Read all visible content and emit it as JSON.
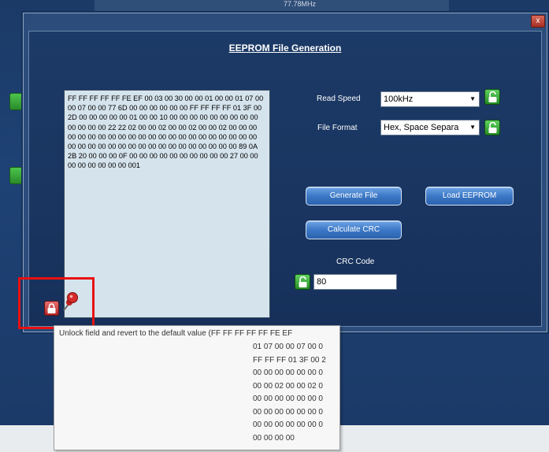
{
  "window": {
    "title": "EEPROM File Generation",
    "close_label": "x",
    "background_top_text": "77.78MHz"
  },
  "hex_data": "FF FF FF FF FF FE EF 00 03 00 30 00 00 01 00 00 01 07 00 00 07 00 00 77 6D 00 00 00 00 00 00 FF FF FF FF 01 3F 00 2D 00 00 00 00 00 01 00 00 10 00 00 00 00 00 00 00 00 00 00 00 00 00 22 22 02 00 00 02 00 00 02 00 00 02 00 00 00 00 00 00 00 00 00 00 00 00 00 00 00 00 00 00 00 00 00 00 00 00 00 00 00 00 00 00 00 00 00 00 00 00 00 00 00 89 0A 2B 20 00 00 00 0F 00 00 00 00 00 00 00 00 00 00 27 00 00 00 00 00 00 00 00 001",
  "read_speed": {
    "label": "Read Speed",
    "value": "100kHz"
  },
  "file_format": {
    "label": "File Format",
    "value": "Hex, Space Separa"
  },
  "buttons": {
    "generate": "Generate File",
    "load": "Load EEPROM",
    "crc": "Calculate CRC"
  },
  "crc_code": {
    "label": "CRC Code",
    "value": "80"
  },
  "tooltip": {
    "head": "Unlock field and revert to the default value (FF FF FF FF FF FE EF",
    "lines": [
      "01 07 00 00 07 00 0",
      "FF FF FF 01 3F 00 2",
      "00 00 00 00 00 00 0",
      "00 00 02 00 00 02 0",
      "00 00 00 00 00 00 0",
      "00 00 00 00 00 00 0",
      "00 00 00 00 00 00 0",
      "00 00 00 00"
    ]
  },
  "colors": {
    "accent_button": "#3c78c6",
    "lock_green": "#2a8a2a",
    "lock_red": "#b42626",
    "highlight_red": "#e81010"
  }
}
